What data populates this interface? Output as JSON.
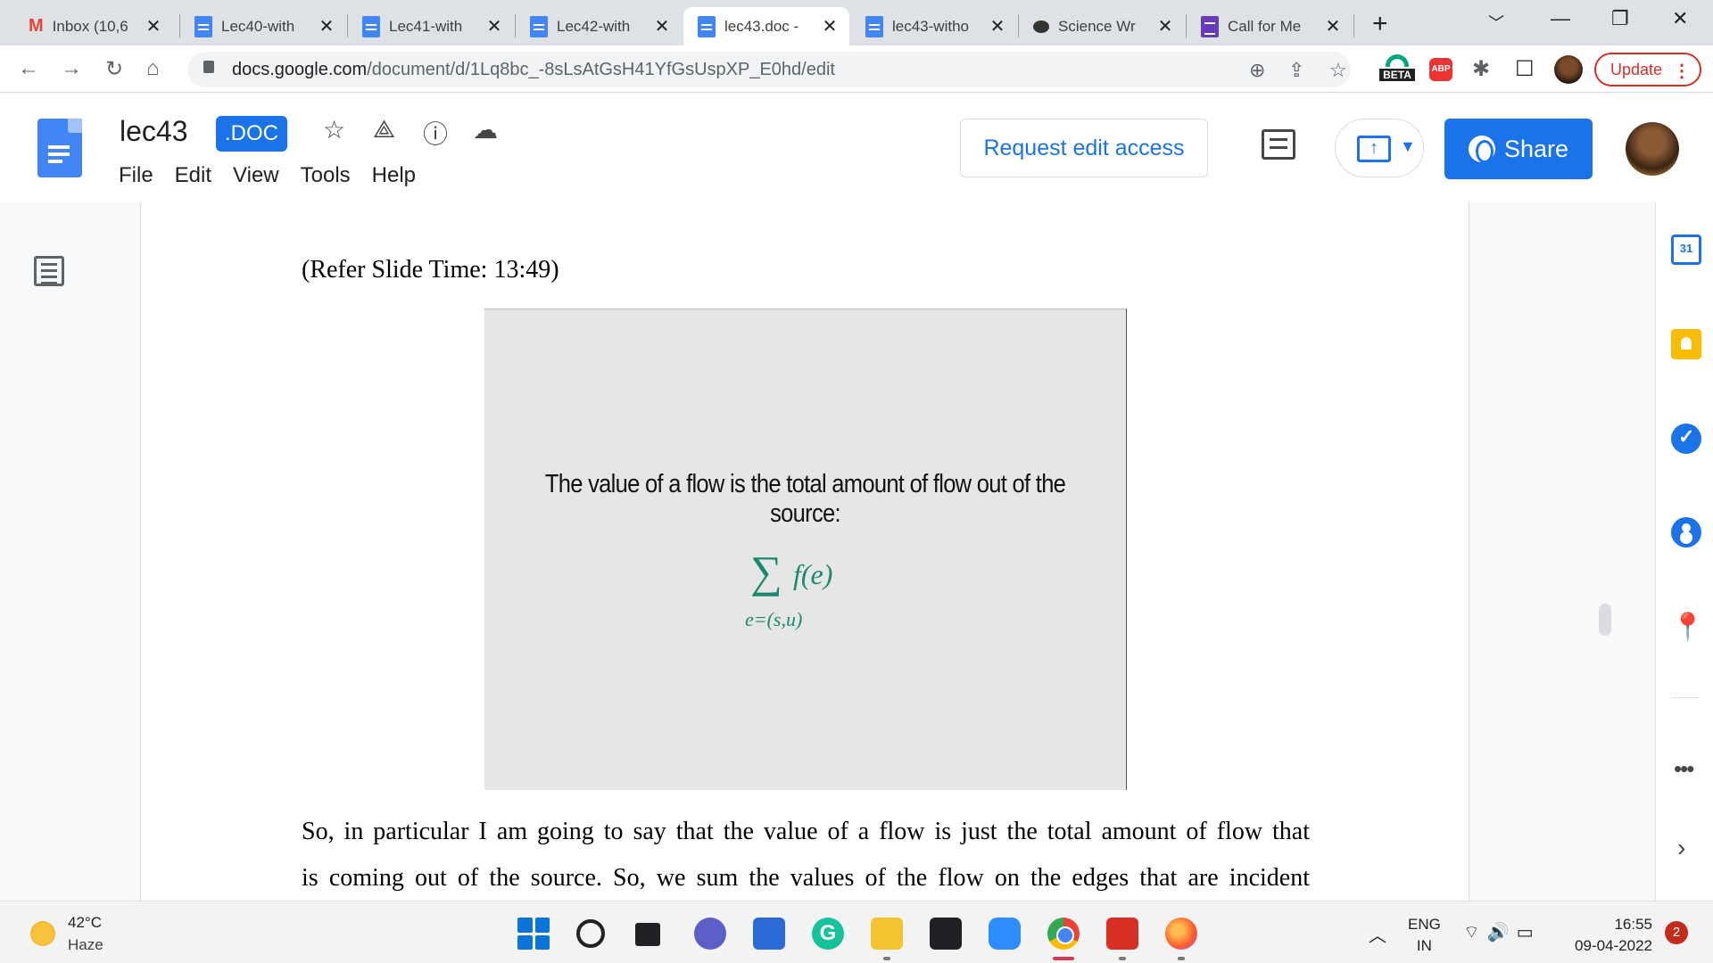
{
  "browser": {
    "tabs": [
      {
        "title": "Inbox (10,6",
        "icon": "gmail-icon"
      },
      {
        "title": "Lec40-with",
        "icon": "docs-icon"
      },
      {
        "title": "Lec41-with",
        "icon": "docs-icon"
      },
      {
        "title": "Lec42-with",
        "icon": "docs-icon"
      },
      {
        "title": "lec43.doc -",
        "icon": "docs-icon",
        "active": true
      },
      {
        "title": "lec43-witho",
        "icon": "docs-icon"
      },
      {
        "title": "Science Wr",
        "icon": "chat-icon"
      },
      {
        "title": "Call for Me",
        "icon": "forms-icon"
      }
    ],
    "url_host": "docs.google.com",
    "url_path": "/document/d/1Lq8bc_-8sLsAtGsH41YfGsUspXP_E0hd/edit",
    "extension_beta_label": "BETA",
    "extension_abp_label": "ABP",
    "update_label": "Update"
  },
  "docs": {
    "title": "lec43",
    "file_badge": ".DOC",
    "menu": [
      "File",
      "Edit",
      "View",
      "Tools",
      "Help"
    ],
    "request_edit_label": "Request edit access",
    "share_label": "Share",
    "accent_color": "#1a73e8"
  },
  "document": {
    "ref_time": "(Refer Slide Time: 13:49)",
    "slide_heading": "The value of a flow is the total amount of flow out of the source:",
    "formula_sigma": "∑",
    "formula_term": "f(e)",
    "formula_sub": "e=(s,u)",
    "body_lines": [
      "So, in particular I am going to say that the value of a flow is just the total amount of flow that",
      "is coming out of the source. So, we sum the values of the flow on the edges that are incident"
    ]
  },
  "side_panel": {
    "calendar_day": "31"
  },
  "taskbar": {
    "temperature": "42°C",
    "condition": "Haze",
    "lang_line1": "ENG",
    "lang_line2": "IN",
    "time": "16:55",
    "date": "09-04-2022",
    "notification_count": "2"
  }
}
